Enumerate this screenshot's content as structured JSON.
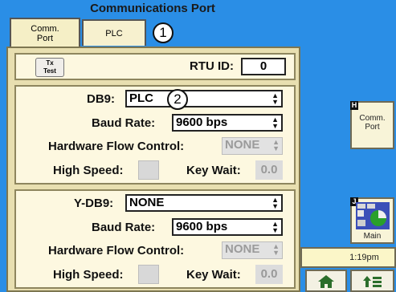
{
  "window": {
    "title": "Communications Port"
  },
  "tabs": [
    {
      "label_line1": "Comm.",
      "label_line2": "Port"
    },
    {
      "label": "PLC"
    }
  ],
  "callouts": [
    "1",
    "2"
  ],
  "top": {
    "tx_test_line1": "Tx",
    "tx_test_line2": "Test",
    "rtu_id_label": "RTU ID:",
    "rtu_id_value": "0"
  },
  "db9": {
    "port_label": "DB9:",
    "port_value": "PLC",
    "baud_label": "Baud Rate:",
    "baud_value": "9600 bps",
    "flow_label": "Hardware Flow Control:",
    "flow_value": "NONE",
    "high_speed_label": "High Speed:",
    "key_wait_label": "Key Wait:",
    "key_wait_value": "0.0"
  },
  "ydb9": {
    "port_label": "Y-DB9:",
    "port_value": "NONE",
    "baud_label": "Baud Rate:",
    "baud_value": "9600 bps",
    "flow_label": "Hardware Flow Control:",
    "flow_value": "NONE",
    "high_speed_label": "High Speed:",
    "key_wait_label": "Key Wait:",
    "key_wait_value": "0.0"
  },
  "sidebar": {
    "h_badge": "H",
    "comm_port_line1": "Comm.",
    "comm_port_line2": "Port",
    "j_badge": "J",
    "main_label": "Main",
    "time": "1:19pm"
  },
  "colors": {
    "background": "#2a8ee6",
    "panel": "#e8dfb0",
    "box": "#fdf8e0"
  }
}
